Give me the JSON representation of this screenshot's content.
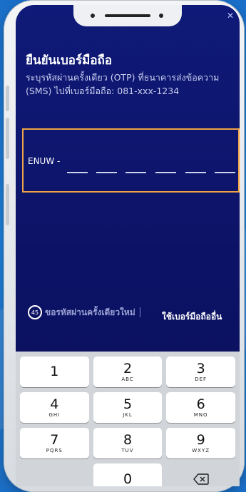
{
  "screen": {
    "title": "ยืนยันเบอร์มือถือ",
    "description": "ระบุรหัสผ่านครั้งเดียว (OTP) ที่ธนาคารส่งข้อความ (SMS) ไปที่เบอร์มือถือ: 081-xxx-1234"
  },
  "otp": {
    "prefix": "ENUW -",
    "digits": [
      "",
      "",
      "",
      "",
      "",
      ""
    ]
  },
  "actions": {
    "timer": "45",
    "resend_label": "ขอรหัสผ่านครั้งเดียวใหม่",
    "other_number_label": "ใช้เบอร์มือถืออื่น"
  },
  "keypad": {
    "keys": [
      {
        "num": "1",
        "letters": ""
      },
      {
        "num": "2",
        "letters": "ABC"
      },
      {
        "num": "3",
        "letters": "DEF"
      },
      {
        "num": "4",
        "letters": "GHI"
      },
      {
        "num": "5",
        "letters": "JKL"
      },
      {
        "num": "6",
        "letters": "MNO"
      },
      {
        "num": "7",
        "letters": "PQRS"
      },
      {
        "num": "8",
        "letters": "TUV"
      },
      {
        "num": "9",
        "letters": "WXYZ"
      },
      {
        "num": "0",
        "letters": ""
      }
    ],
    "backspace_icon": "backspace-icon"
  },
  "colors": {
    "screen_bg": "#0f1a78",
    "otp_border": "#f0a445",
    "page_bg": "#1f7fd8"
  }
}
